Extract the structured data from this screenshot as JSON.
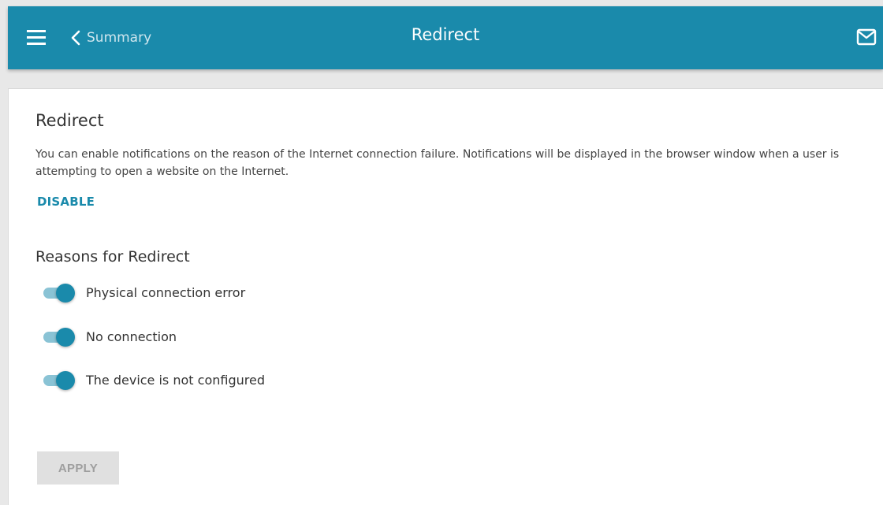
{
  "header": {
    "back_label": "Summary",
    "title": "Redirect",
    "accent_color": "#1a8aab"
  },
  "icons": {
    "menu": "hamburger-menu-icon",
    "back": "chevron-left-icon",
    "notifications": "mail-envelope-icon"
  },
  "main": {
    "section_title": "Redirect",
    "description": "You can enable notifications on the reason of the Internet connection failure. Notifications will be displayed in the browser window when a user is attempting to open a website on the Internet.",
    "disable_label": "DISABLE",
    "reasons_title": "Reasons for Redirect",
    "reasons": [
      {
        "label": "Physical connection error",
        "enabled": true
      },
      {
        "label": "No connection",
        "enabled": true
      },
      {
        "label": "The device is not configured",
        "enabled": true
      }
    ],
    "apply_label": "APPLY"
  }
}
